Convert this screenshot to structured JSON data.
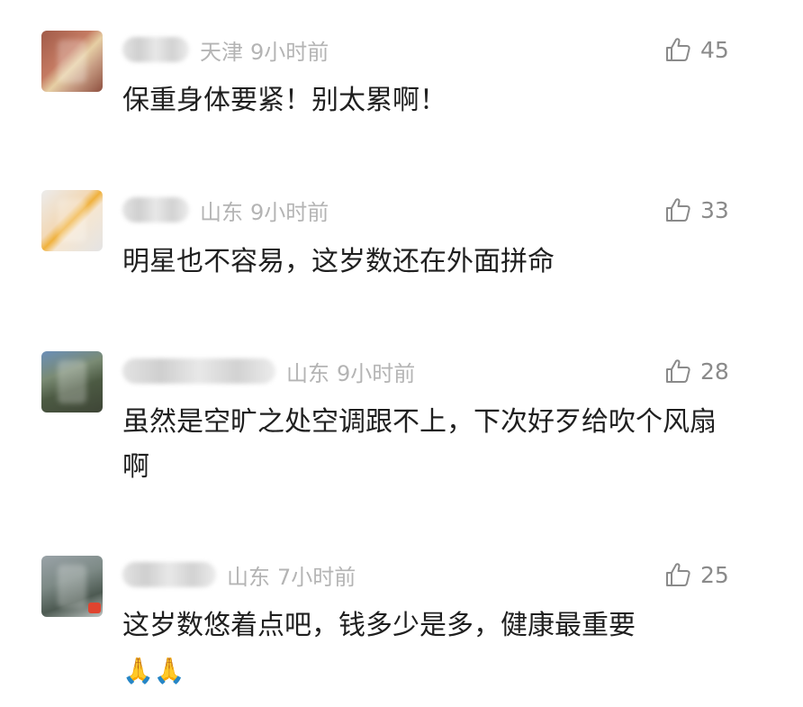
{
  "comments": [
    {
      "location": "天津",
      "time": "9小时前",
      "likes": "45",
      "text": "保重身体要紧！别太累啊！"
    },
    {
      "location": "山东",
      "time": "9小时前",
      "likes": "33",
      "text": "明星也不容易，这岁数还在外面拼命"
    },
    {
      "location": "山东",
      "time": "9小时前",
      "likes": "28",
      "text": "虽然是空旷之处空调跟不上，下次好歹给吹个风扇啊"
    },
    {
      "location": "山东",
      "time": "7小时前",
      "likes": "25",
      "text": "这岁数悠着点吧，钱多少是多，健康最重要",
      "emoji": "🙏🙏"
    }
  ],
  "icons": {
    "like": "thumbs-up-icon"
  },
  "colors": {
    "meta_text": "#b4b4b4",
    "like_count": "#8a8a8a",
    "comment_text": "#1f1f1f"
  }
}
